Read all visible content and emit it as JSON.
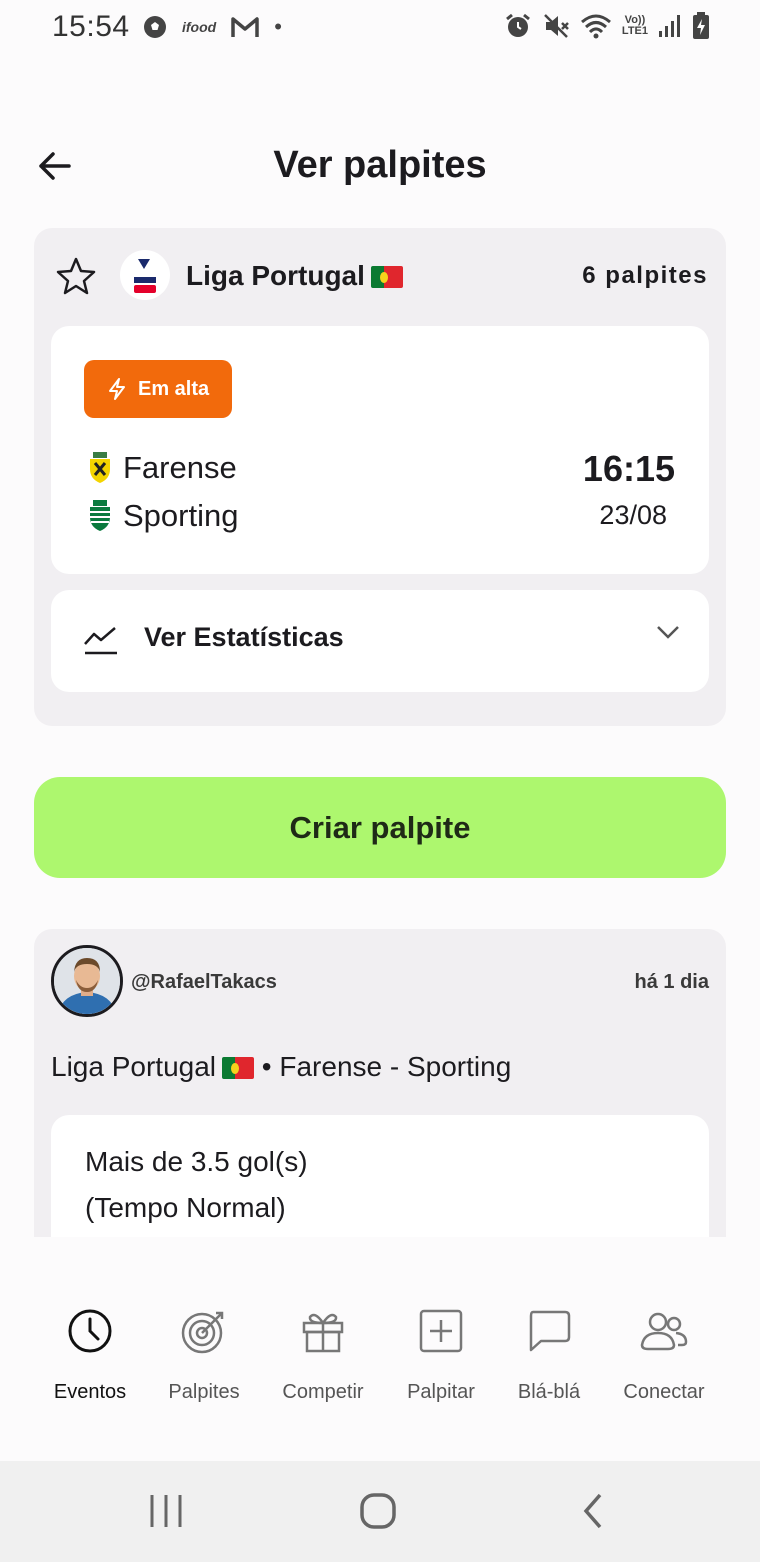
{
  "status_bar": {
    "time": "15:54",
    "left_icons": [
      "soccer-ball-icon",
      "ifood-icon",
      "gmail-icon",
      "dot-icon"
    ],
    "ifood_text": "ifood",
    "dot": "•",
    "lte_top": "Vo))",
    "lte_bottom": "LTE1",
    "right_icons": [
      "alarm-icon",
      "mute-icon",
      "wifi-icon",
      "lte-icon",
      "signal-icon",
      "battery-icon"
    ]
  },
  "header": {
    "title": "Ver palpites",
    "back_icon": "arrow-left-icon"
  },
  "event": {
    "league_name": "Liga Portugal",
    "palpites_count": "6 palpites",
    "badge_label": "Em alta",
    "team_home": "Farense",
    "team_away": "Sporting",
    "time": "16:15",
    "date": "23/08",
    "stats_label": "Ver Estatísticas"
  },
  "actions": {
    "create_label": "Criar palpite"
  },
  "tip": {
    "username": "@RafaelTakacs",
    "time_ago": "há 1 dia",
    "league": "Liga Portugal",
    "match": "• Farense - Sporting",
    "market_line1": "Mais de 3.5 gol(s)",
    "market_line2": "(Tempo Normal)"
  },
  "nav": {
    "items": [
      {
        "label": "Eventos",
        "icon": "clock-icon",
        "active": true
      },
      {
        "label": "Palpites",
        "icon": "target-icon",
        "active": false
      },
      {
        "label": "Competir",
        "icon": "gift-icon",
        "active": false
      },
      {
        "label": "Palpitar",
        "icon": "plus-square-icon",
        "active": false
      },
      {
        "label": "Blá-blá",
        "icon": "chat-bubble-icon",
        "active": false
      },
      {
        "label": "Conectar",
        "icon": "users-icon",
        "active": false
      }
    ]
  },
  "colors": {
    "accent_green": "#adf76e",
    "badge_orange": "#f26a0c",
    "card_bg": "#f1eff2"
  }
}
